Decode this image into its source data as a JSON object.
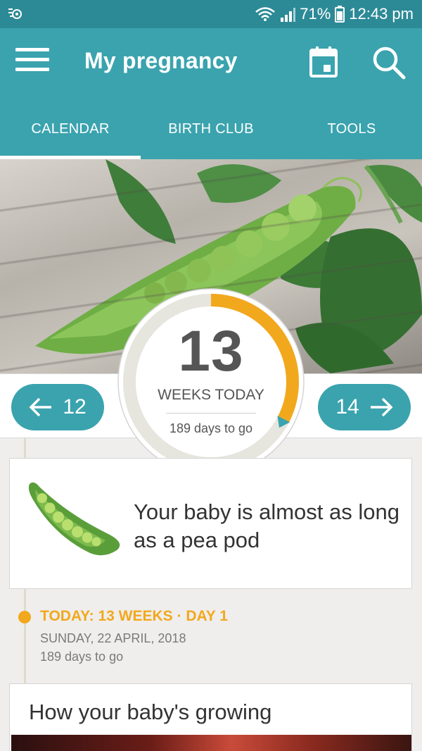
{
  "status_bar": {
    "battery": "71%",
    "time": "12:43 pm",
    "icons": [
      "notification-icon",
      "wifi-icon",
      "signal-icon",
      "battery-icon"
    ]
  },
  "app_bar": {
    "title": "My pregnancy",
    "icons": [
      "menu-icon",
      "calendar-icon",
      "search-icon"
    ],
    "color": "#3aa3ae"
  },
  "tabs": [
    {
      "label": "CALENDAR",
      "active": true
    },
    {
      "label": "BIRTH CLUB",
      "active": false
    },
    {
      "label": "TOOLS",
      "active": false
    }
  ],
  "week_nav": {
    "prev_week": "12",
    "next_week": "14"
  },
  "progress": {
    "week": "13",
    "label": "WEEKS TODAY",
    "days_to_go": "189 days to go",
    "fraction_complete": 0.325,
    "ring_color": "#f2a81d"
  },
  "size_card": {
    "text": "Your baby is almost as long as a pea pod",
    "icon": "pea-pod-icon"
  },
  "today": {
    "heading": "TODAY: 13 WEEKS · DAY 1",
    "date": "SUNDAY, 22 APRIL, 2018",
    "days_to_go": "189 days to go",
    "accent": "#f2a81d"
  },
  "growth_card": {
    "title": "How your baby's growing"
  }
}
